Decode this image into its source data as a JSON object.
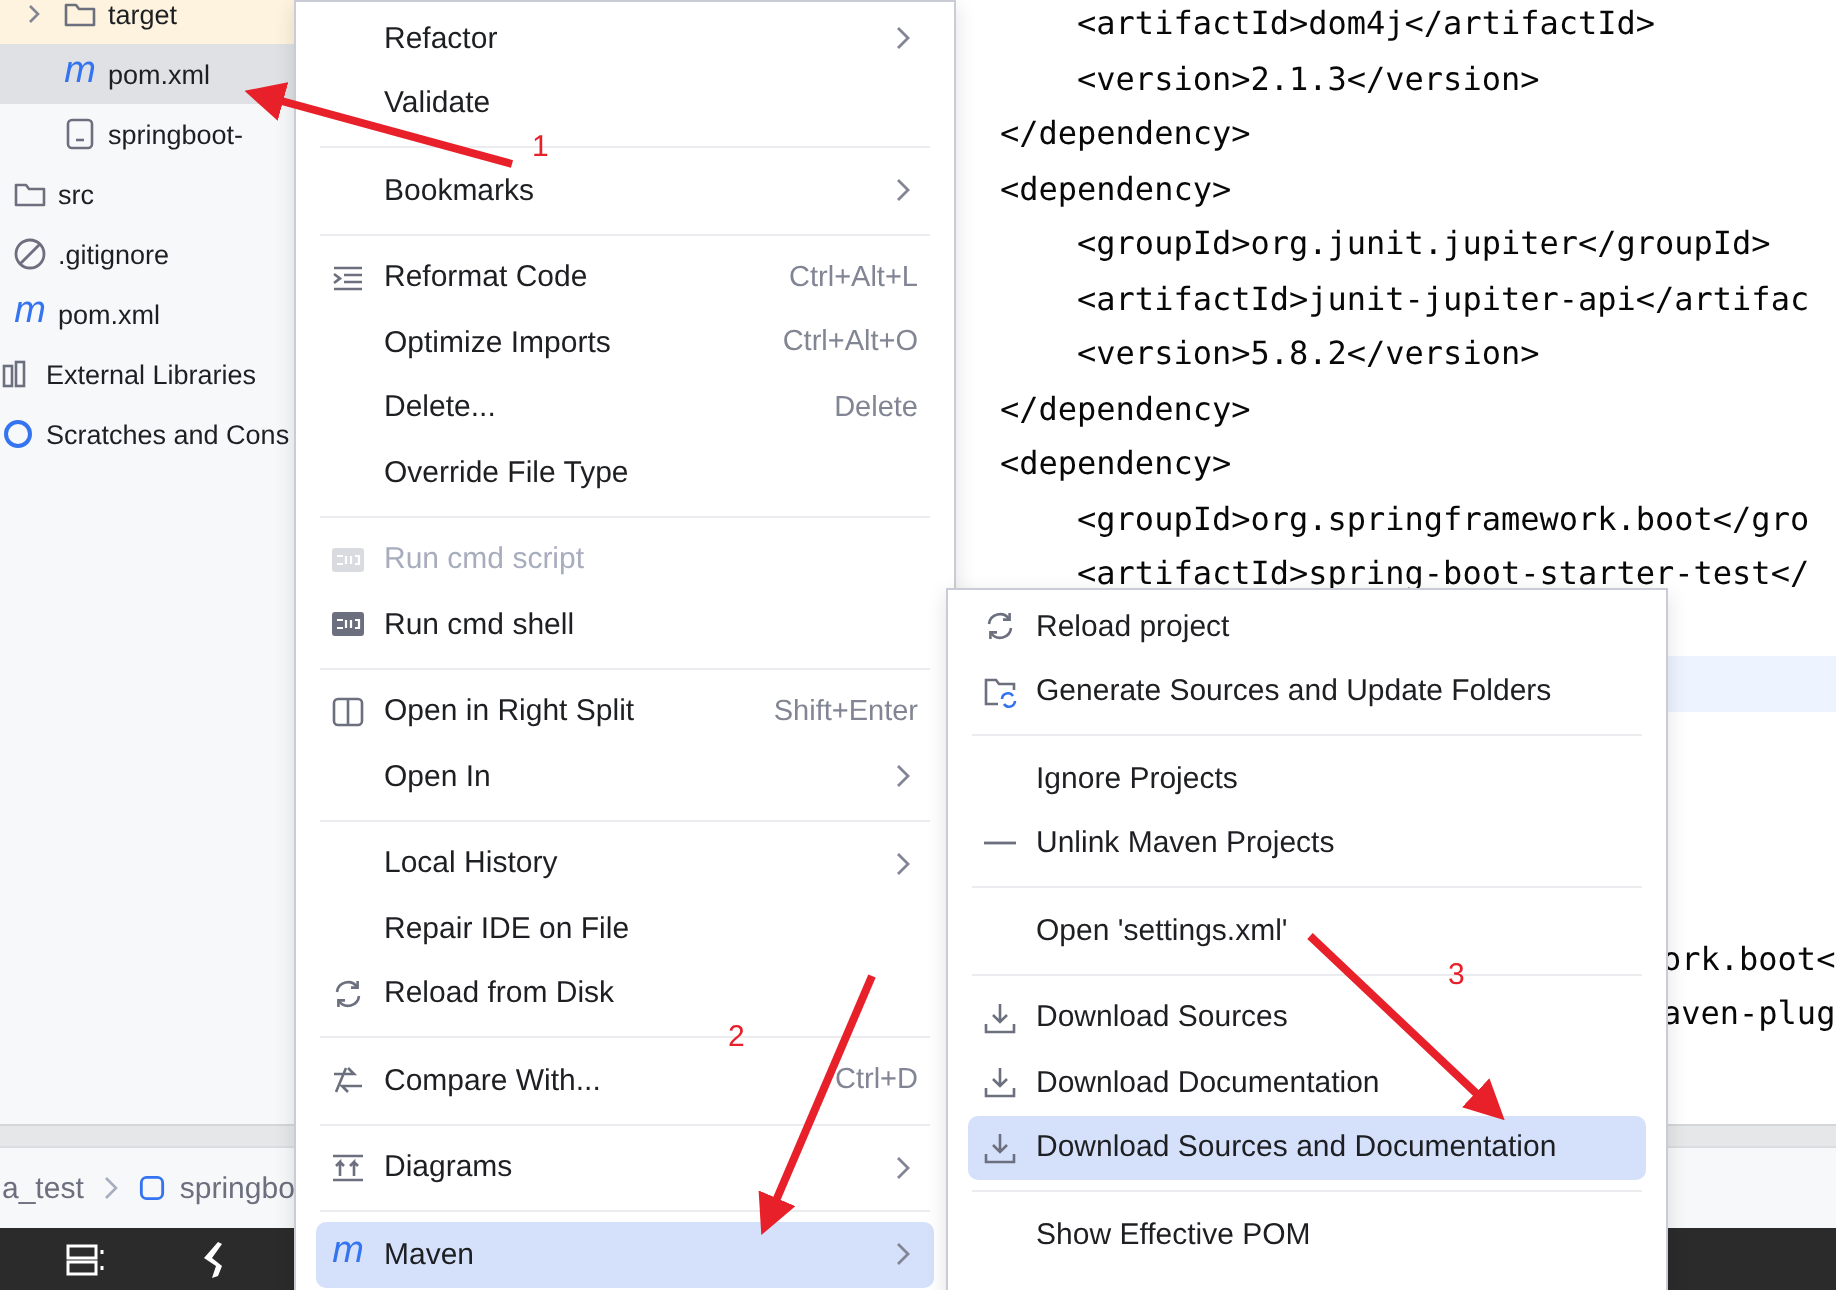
{
  "tree": {
    "items": [
      {
        "children": [
          {
            "children": [
              {
                "label": "target",
                "kind": "folder",
                "expanded": false,
                "selected": false,
                "excluded": true
              },
              {
                "label": "pom.xml",
                "kind": "maven",
                "glyph": "m",
                "selected": true,
                "excluded": false
              },
              {
                "label": "springboot-",
                "kind": "file",
                "selected": false,
                "excluded": false
              }
            ]
          },
          {
            "label": "src",
            "kind": "folder",
            "selected": false,
            "excluded": false
          },
          {
            "label": ".gitignore",
            "kind": "ignore",
            "selected": false,
            "excluded": false
          },
          {
            "label": "pom.xml",
            "kind": "maven",
            "glyph": "m",
            "selected": false,
            "excluded": false
          }
        ]
      },
      {
        "label": "External Libraries",
        "kind": "library",
        "selected": false,
        "excluded": false
      },
      {
        "label": "Scratches and Cons",
        "kind": "scratch",
        "selected": false,
        "excluded": false
      }
    ]
  },
  "editor": {
    "lines": [
      {
        "kind": "code",
        "text": "    <artifactId>dom4j</artifactId>",
        "current": false
      },
      {
        "kind": "code",
        "text": "    <version>2.1.3</version>",
        "current": false
      },
      {
        "kind": "code",
        "text": "</dependency>",
        "current": false
      },
      {
        "kind": "code",
        "text": "<dependency>",
        "current": false
      },
      {
        "kind": "code",
        "text": "    <groupId>org.junit.jupiter</groupId>",
        "current": false
      },
      {
        "kind": "code",
        "text": "    <artifactId>junit-jupiter-api</artifac",
        "current": false
      },
      {
        "kind": "code",
        "text": "    <version>5.8.2</version>",
        "current": false
      },
      {
        "kind": "code",
        "text": "</dependency>",
        "current": false
      },
      {
        "kind": "code",
        "text": "<dependency>",
        "current": false
      },
      {
        "kind": "code",
        "text": "    <groupId>org.springframework.boot</gro",
        "current": false
      },
      {
        "kind": "code",
        "text": "    <artifactId>spring-boot-starter-test</",
        "current": false
      },
      {
        "kind": "tail",
        "current": false
      },
      {
        "kind": "tail",
        "current": true
      },
      {
        "kind": "tail",
        "current": false
      },
      {
        "kind": "tail",
        "current": false
      },
      {
        "kind": "tail",
        "current": false
      },
      {
        "kind": "tail",
        "current": false
      },
      {
        "kind": "tail",
        "text": "ork.boot<",
        "current": false
      },
      {
        "kind": "tail",
        "text": "aven-plug",
        "current": false
      }
    ]
  },
  "breadcrumb": [
    {
      "label": "a_test"
    },
    {
      "label": "springbo"
    }
  ],
  "menu": {
    "items": [
      {
        "kind": "item",
        "label": "Refactor",
        "submenu": true,
        "disabled": false,
        "selected": false
      },
      {
        "kind": "item",
        "label": "Validate",
        "disabled": false,
        "selected": false
      },
      {
        "kind": "separator"
      },
      {
        "kind": "item",
        "label": "Bookmarks",
        "submenu": true,
        "disabled": false,
        "selected": false
      },
      {
        "kind": "separator"
      },
      {
        "kind": "item",
        "label": "Reformat Code",
        "shortcut": "Ctrl+Alt+L",
        "disabled": false,
        "selected": false
      },
      {
        "kind": "item",
        "label": "Optimize Imports",
        "shortcut": "Ctrl+Alt+O",
        "disabled": false,
        "selected": false
      },
      {
        "kind": "item",
        "label": "Delete...",
        "shortcut": "Delete",
        "disabled": false,
        "selected": false
      },
      {
        "kind": "item",
        "label": "Override File Type",
        "disabled": false,
        "selected": false
      },
      {
        "kind": "separator"
      },
      {
        "kind": "item",
        "label": "Run cmd script",
        "disabled": true,
        "selected": false
      },
      {
        "kind": "item",
        "label": "Run cmd shell",
        "disabled": false,
        "selected": false
      },
      {
        "kind": "separator"
      },
      {
        "kind": "item",
        "label": "Open in Right Split",
        "shortcut": "Shift+Enter",
        "disabled": false,
        "selected": false
      },
      {
        "kind": "item",
        "label": "Open In",
        "submenu": true,
        "disabled": false,
        "selected": false
      },
      {
        "kind": "separator"
      },
      {
        "kind": "item",
        "label": "Local History",
        "submenu": true,
        "disabled": false,
        "selected": false
      },
      {
        "kind": "item",
        "label": "Repair IDE on File",
        "disabled": false,
        "selected": false
      },
      {
        "kind": "item",
        "label": "Reload from Disk",
        "disabled": false,
        "selected": false
      },
      {
        "kind": "separator"
      },
      {
        "kind": "item",
        "label": "Compare With...",
        "shortcut": "Ctrl+D",
        "disabled": false,
        "selected": false
      },
      {
        "kind": "separator"
      },
      {
        "kind": "item",
        "label": "Diagrams",
        "submenu": true,
        "disabled": false,
        "selected": false
      },
      {
        "kind": "separator"
      },
      {
        "kind": "item",
        "label": "Maven",
        "glyph": "m",
        "submenu": true,
        "disabled": false,
        "selected": true
      }
    ]
  },
  "submenu": {
    "items": [
      {
        "kind": "item",
        "label": "Reload project",
        "disabled": false,
        "selected": false
      },
      {
        "kind": "item",
        "label": "Generate Sources and Update Folders",
        "disabled": false,
        "selected": false
      },
      {
        "kind": "separator"
      },
      {
        "kind": "item",
        "label": "Ignore Projects",
        "disabled": false,
        "selected": false
      },
      {
        "kind": "item",
        "label": "Unlink Maven Projects",
        "disabled": false,
        "selected": false
      },
      {
        "kind": "separator"
      },
      {
        "kind": "item",
        "label": "Open 'settings.xml'",
        "disabled": false,
        "selected": false
      },
      {
        "kind": "separator"
      },
      {
        "kind": "item",
        "label": "Download Sources",
        "disabled": false,
        "selected": false
      },
      {
        "kind": "item",
        "label": "Download Documentation",
        "disabled": false,
        "selected": false
      },
      {
        "kind": "item",
        "label": "Download Sources and Documentation",
        "disabled": false,
        "selected": true
      },
      {
        "kind": "separator"
      },
      {
        "kind": "item",
        "label": "Show Effective POM",
        "disabled": false,
        "selected": false
      }
    ]
  },
  "annotations": [
    {
      "label": "1"
    },
    {
      "label": "2"
    },
    {
      "label": "3"
    }
  ]
}
